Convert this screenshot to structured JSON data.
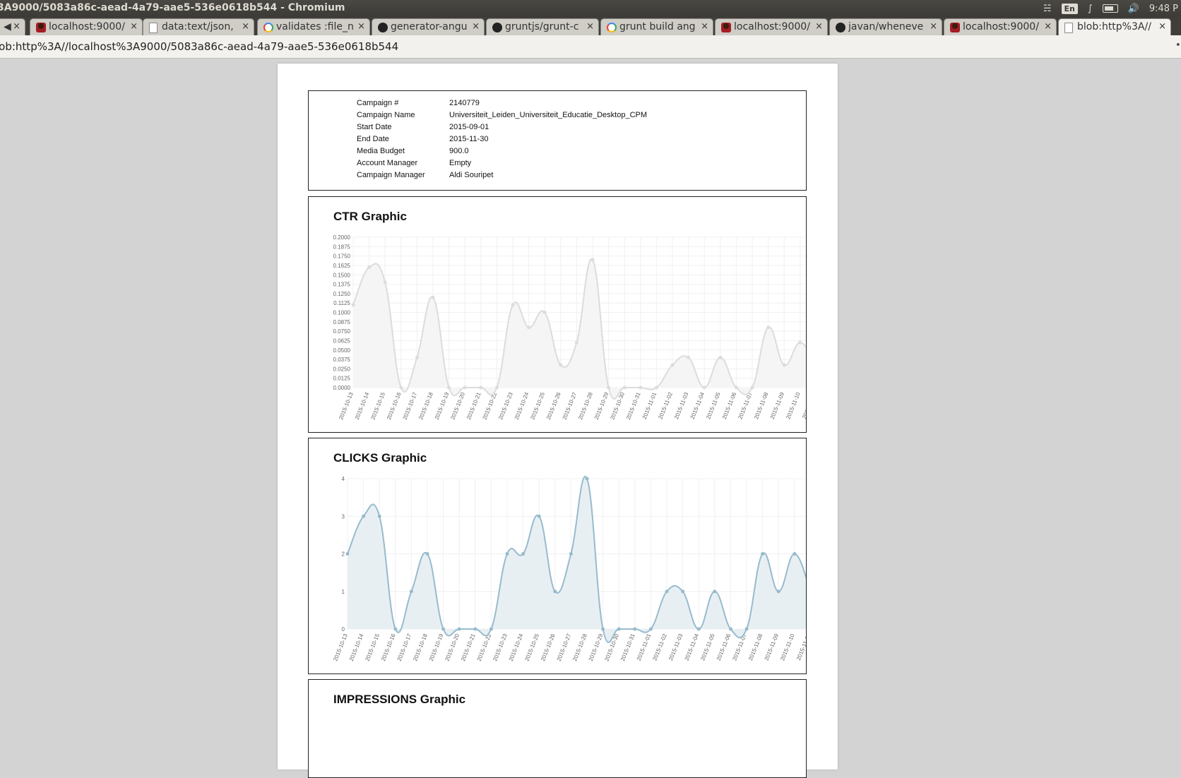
{
  "window": {
    "title": "3A9000/5083a86c-aead-4a79-aae5-536e0618b544 - Chromium",
    "lang": "En",
    "clock": "9:48 P"
  },
  "tabs": [
    {
      "label": "",
      "icon": "back-icon"
    },
    {
      "label": "localhost:9000/",
      "icon": "yeoman-favicon"
    },
    {
      "label": "data:text/json,",
      "icon": "document-favicon"
    },
    {
      "label": "validates :file_n",
      "icon": "google-favicon"
    },
    {
      "label": "generator-angu",
      "icon": "github-favicon"
    },
    {
      "label": "gruntjs/grunt-c",
      "icon": "github-favicon"
    },
    {
      "label": "grunt build ang",
      "icon": "google-favicon"
    },
    {
      "label": "localhost:9000/",
      "icon": "yeoman-favicon"
    },
    {
      "label": "javan/wheneve",
      "icon": "github-favicon"
    },
    {
      "label": "localhost:9000/",
      "icon": "yeoman-favicon"
    },
    {
      "label": "blob:http%3A//",
      "icon": "document-favicon",
      "active": true
    }
  ],
  "address": {
    "url": "lob:http%3A//localhost%3A9000/5083a86c-aead-4a79-aae5-536e0618b544"
  },
  "campaign": {
    "rows": [
      {
        "label": "Campaign #",
        "value": "2140779"
      },
      {
        "label": "Campaign Name",
        "value": "Universiteit_Leiden_Universiteit_Educatie_Desktop_CPM"
      },
      {
        "label": "Start Date",
        "value": "2015-09-01"
      },
      {
        "label": "End Date",
        "value": "2015-11-30"
      },
      {
        "label": "Media Budget",
        "value": "900.0"
      },
      {
        "label": "Account Manager",
        "value": "Empty"
      },
      {
        "label": "Campaign Manager",
        "value": "Aldi Souripet"
      }
    ]
  },
  "sections": {
    "ctr_title": "CTR Graphic",
    "clicks_title": "CLICKS Graphic",
    "impressions_title": "IMPRESSIONS Graphic"
  },
  "chart_data": [
    {
      "type": "area",
      "title": "CTR Graphic",
      "x": [
        "2015-10-13",
        "2015-10-14",
        "2015-10-15",
        "2015-10-16",
        "2015-10-17",
        "2015-10-18",
        "2015-10-19",
        "2015-10-20",
        "2015-10-21",
        "2015-10-22",
        "2015-10-23",
        "2015-10-24",
        "2015-10-25",
        "2015-10-26",
        "2015-10-27",
        "2015-10-28",
        "2015-10-29",
        "2015-10-30",
        "2015-10-31",
        "2015-11-01",
        "2015-11-02",
        "2015-11-03",
        "2015-11-04",
        "2015-11-05",
        "2015-11-06",
        "2015-11-07",
        "2015-11-08",
        "2015-11-09",
        "2015-11-10",
        "2015-11-11"
      ],
      "values": [
        0.11,
        0.16,
        0.14,
        0,
        0.04,
        0.12,
        0,
        0,
        0,
        0,
        0.11,
        0.08,
        0.1,
        0.03,
        0.06,
        0.17,
        0,
        0,
        0,
        0,
        0.03,
        0.04,
        0,
        0.04,
        0,
        0,
        0.08,
        0.03,
        0.06,
        0.03
      ],
      "yticks": [
        "0.0000",
        "0.0125",
        "0.0250",
        "0.0375",
        "0.0500",
        "0.0625",
        "0.0750",
        "0.0875",
        "0.1000",
        "0.1125",
        "0.1250",
        "0.1375",
        "0.1500",
        "0.1625",
        "0.1750",
        "0.1875",
        "0.2000"
      ],
      "ylim": [
        0,
        0.2
      ],
      "grid": true,
      "color": "#dcdcdc",
      "fill": "#f5f5f5"
    },
    {
      "type": "area",
      "title": "CLICKS Graphic",
      "x": [
        "2015-10-13",
        "2015-10-14",
        "2015-10-15",
        "2015-10-16",
        "2015-10-17",
        "2015-10-18",
        "2015-10-19",
        "2015-10-20",
        "2015-10-21",
        "2015-10-22",
        "2015-10-23",
        "2015-10-24",
        "2015-10-25",
        "2015-10-26",
        "2015-10-27",
        "2015-10-28",
        "2015-10-29",
        "2015-10-30",
        "2015-10-31",
        "2015-11-01",
        "2015-11-02",
        "2015-11-03",
        "2015-11-04",
        "2015-11-05",
        "2015-11-06",
        "2015-11-07",
        "2015-11-08",
        "2015-11-09",
        "2015-11-10",
        "2015-11-11"
      ],
      "values": [
        2,
        3,
        3,
        0,
        1,
        2,
        0,
        0,
        0,
        0,
        2,
        2,
        3,
        1,
        2,
        4,
        0,
        0,
        0,
        0,
        1,
        1,
        0,
        1,
        0,
        0,
        2,
        1,
        2,
        1
      ],
      "yticks": [
        "0",
        "1",
        "2",
        "3",
        "4"
      ],
      "ylim": [
        0,
        4
      ],
      "grid": true,
      "color": "#97bbcd",
      "fill": "#e8eff3"
    }
  ]
}
